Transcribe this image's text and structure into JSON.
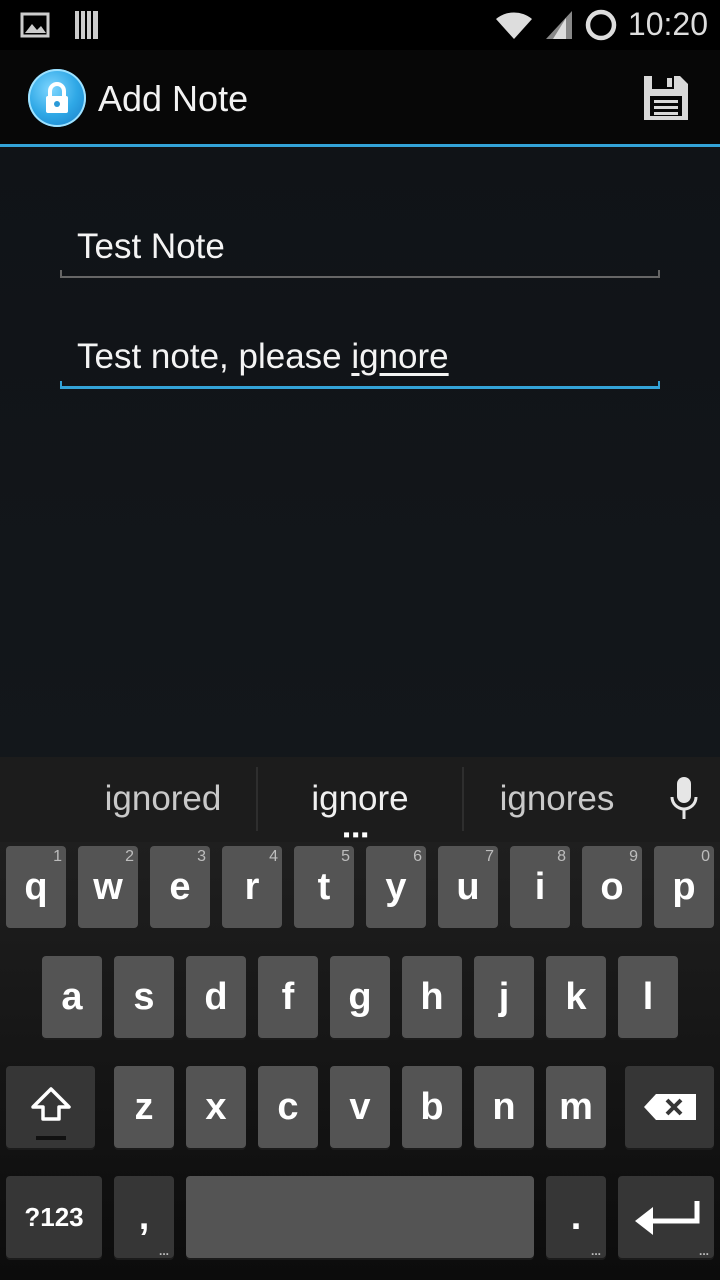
{
  "status_bar": {
    "time": "10:20",
    "icons": [
      "gallery-icon",
      "barcode-icon",
      "wifi-icon",
      "signal-icon",
      "sync-icon"
    ]
  },
  "action_bar": {
    "title": "Add Note",
    "icon": "lock-icon",
    "save_icon": "floppy-save-icon"
  },
  "form": {
    "title_value": "Test Note",
    "body_prefix": "Test note, please ",
    "body_composing": "ignore"
  },
  "keyboard": {
    "suggestions": [
      "ignored",
      "ignore",
      "ignores"
    ],
    "row1": [
      {
        "label": "q",
        "hint": "1"
      },
      {
        "label": "w",
        "hint": "2"
      },
      {
        "label": "e",
        "hint": "3"
      },
      {
        "label": "r",
        "hint": "4"
      },
      {
        "label": "t",
        "hint": "5"
      },
      {
        "label": "y",
        "hint": "6"
      },
      {
        "label": "u",
        "hint": "7"
      },
      {
        "label": "i",
        "hint": "8"
      },
      {
        "label": "o",
        "hint": "9"
      },
      {
        "label": "p",
        "hint": "0"
      }
    ],
    "row2": [
      "a",
      "s",
      "d",
      "f",
      "g",
      "h",
      "j",
      "k",
      "l"
    ],
    "row3": [
      "z",
      "x",
      "c",
      "v",
      "b",
      "n",
      "m"
    ],
    "symbols_label": "?123",
    "comma_label": ",",
    "period_label": ".",
    "more_marker": "..."
  },
  "colors": {
    "accent": "#33a3d8",
    "key": "#545454",
    "key_dark": "#363636",
    "background": "#101317"
  }
}
